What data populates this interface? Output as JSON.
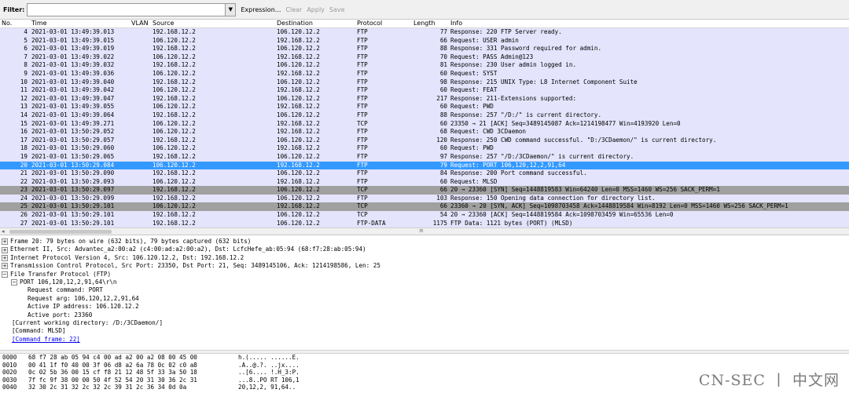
{
  "toolbar": {
    "filter_label": "Filter:",
    "filter_value": "",
    "expression_label": "Expression...",
    "clear_label": "Clear",
    "apply_label": "Apply",
    "save_label": "Save"
  },
  "packet_list": {
    "columns": {
      "no": "No.",
      "time": "Time",
      "vlan": "VLAN",
      "source": "Source",
      "destination": "Destination",
      "protocol": "Protocol",
      "length": "Length",
      "info": "Info"
    },
    "rows": [
      {
        "no": "4",
        "time": "2021-03-01 13:49:39.013",
        "src": "192.168.12.2",
        "dst": "106.120.12.2",
        "proto": "FTP",
        "len": "77",
        "info": "Response: 220 FTP Server ready.",
        "style": "ftp"
      },
      {
        "no": "5",
        "time": "2021-03-01 13:49:39.015",
        "src": "106.120.12.2",
        "dst": "192.168.12.2",
        "proto": "FTP",
        "len": "66",
        "info": "Request: USER admin",
        "style": "ftp"
      },
      {
        "no": "6",
        "time": "2021-03-01 13:49:39.019",
        "src": "192.168.12.2",
        "dst": "106.120.12.2",
        "proto": "FTP",
        "len": "88",
        "info": "Response: 331 Password required for admin.",
        "style": "ftp"
      },
      {
        "no": "7",
        "time": "2021-03-01 13:49:39.022",
        "src": "106.120.12.2",
        "dst": "192.168.12.2",
        "proto": "FTP",
        "len": "70",
        "info": "Request: PASS Admin@123",
        "style": "ftp"
      },
      {
        "no": "8",
        "time": "2021-03-01 13:49:39.032",
        "src": "192.168.12.2",
        "dst": "106.120.12.2",
        "proto": "FTP",
        "len": "81",
        "info": "Response: 230 User admin logged in.",
        "style": "ftp"
      },
      {
        "no": "9",
        "time": "2021-03-01 13:49:39.036",
        "src": "106.120.12.2",
        "dst": "192.168.12.2",
        "proto": "FTP",
        "len": "60",
        "info": "Request: SYST",
        "style": "ftp"
      },
      {
        "no": "10",
        "time": "2021-03-01 13:49:39.040",
        "src": "192.168.12.2",
        "dst": "106.120.12.2",
        "proto": "FTP",
        "len": "98",
        "info": "Response: 215 UNIX Type: L8 Internet Component Suite",
        "style": "ftp"
      },
      {
        "no": "11",
        "time": "2021-03-01 13:49:39.042",
        "src": "106.120.12.2",
        "dst": "192.168.12.2",
        "proto": "FTP",
        "len": "60",
        "info": "Request: FEAT",
        "style": "ftp"
      },
      {
        "no": "12",
        "time": "2021-03-01 13:49:39.047",
        "src": "192.168.12.2",
        "dst": "106.120.12.2",
        "proto": "FTP",
        "len": "217",
        "info": "Response: 211-Extensions supported:",
        "style": "ftp"
      },
      {
        "no": "13",
        "time": "2021-03-01 13:49:39.055",
        "src": "106.120.12.2",
        "dst": "192.168.12.2",
        "proto": "FTP",
        "len": "60",
        "info": "Request: PWD",
        "style": "ftp"
      },
      {
        "no": "14",
        "time": "2021-03-01 13:49:39.064",
        "src": "192.168.12.2",
        "dst": "106.120.12.2",
        "proto": "FTP",
        "len": "88",
        "info": "Response: 257 \"/D:/\" is current directory.",
        "style": "ftp"
      },
      {
        "no": "15",
        "time": "2021-03-01 13:49:39.271",
        "src": "106.120.12.2",
        "dst": "192.168.12.2",
        "proto": "TCP",
        "len": "60",
        "info": "23350 → 21 [ACK] Seq=3489145087 Ack=1214198477 Win=4193920 Len=0",
        "style": "tcp"
      },
      {
        "no": "16",
        "time": "2021-03-01 13:50:29.052",
        "src": "106.120.12.2",
        "dst": "192.168.12.2",
        "proto": "FTP",
        "len": "68",
        "info": "Request: CWD 3CDaemon",
        "style": "ftp"
      },
      {
        "no": "17",
        "time": "2021-03-01 13:50:29.057",
        "src": "192.168.12.2",
        "dst": "106.120.12.2",
        "proto": "FTP",
        "len": "120",
        "info": "Response: 250 CWD command successful. \"D:/3CDaemon/\" is current directory.",
        "style": "ftp"
      },
      {
        "no": "18",
        "time": "2021-03-01 13:50:29.060",
        "src": "106.120.12.2",
        "dst": "192.168.12.2",
        "proto": "FTP",
        "len": "60",
        "info": "Request: PWD",
        "style": "ftp"
      },
      {
        "no": "19",
        "time": "2021-03-01 13:50:29.065",
        "src": "192.168.12.2",
        "dst": "106.120.12.2",
        "proto": "FTP",
        "len": "97",
        "info": "Response: 257 \"/D:/3CDaemon/\" is current directory.",
        "style": "ftp"
      },
      {
        "no": "20",
        "time": "2021-03-01 13:50:29.084",
        "src": "106.120.12.2",
        "dst": "192.168.12.2",
        "proto": "FTP",
        "len": "79",
        "info": "Request: PORT 106,120,12,2,91,64",
        "style": "sel"
      },
      {
        "no": "21",
        "time": "2021-03-01 13:50:29.090",
        "src": "192.168.12.2",
        "dst": "106.120.12.2",
        "proto": "FTP",
        "len": "84",
        "info": "Response: 200 Port command successful.",
        "style": "ftp"
      },
      {
        "no": "22",
        "time": "2021-03-01 13:50:29.093",
        "src": "106.120.12.2",
        "dst": "192.168.12.2",
        "proto": "FTP",
        "len": "60",
        "info": "Request: MLSD",
        "style": "ftp"
      },
      {
        "no": "23",
        "time": "2021-03-01 13:50:29.097",
        "src": "192.168.12.2",
        "dst": "106.120.12.2",
        "proto": "TCP",
        "len": "66",
        "info": "20 → 23360 [SYN] Seq=1448819583 Win=64240 Len=0 MSS=1460 WS=256 SACK_PERM=1",
        "style": "dark"
      },
      {
        "no": "24",
        "time": "2021-03-01 13:50:29.099",
        "src": "192.168.12.2",
        "dst": "106.120.12.2",
        "proto": "FTP",
        "len": "103",
        "info": "Response: 150 Opening data connection for directory list.",
        "style": "ftp"
      },
      {
        "no": "25",
        "time": "2021-03-01 13:50:29.101",
        "src": "106.120.12.2",
        "dst": "192.168.12.2",
        "proto": "TCP",
        "len": "66",
        "info": "23360 → 20 [SYN, ACK] Seq=1098703458 Ack=1448819584 Win=8192 Len=0 MSS=1460 WS=256 SACK_PERM=1",
        "style": "dark"
      },
      {
        "no": "26",
        "time": "2021-03-01 13:50:29.101",
        "src": "192.168.12.2",
        "dst": "106.120.12.2",
        "proto": "TCP",
        "len": "54",
        "info": "20 → 23360 [ACK] Seq=1448819584 Ack=1098703459 Win=65536 Len=0",
        "style": "tcp"
      },
      {
        "no": "27",
        "time": "2021-03-01 13:50:29.101",
        "src": "192.168.12.2",
        "dst": "106.120.12.2",
        "proto": "FTP-DATA",
        "len": "1175",
        "info": "FTP Data: 1121 bytes (PORT) (MLSD)",
        "style": "ftpdata"
      }
    ]
  },
  "details": {
    "frame": "Frame 20: 79 bytes on wire (632 bits), 79 bytes captured (632 bits)",
    "ethernet": "Ethernet II, Src: Advantec_a2:00:a2 (c4:00:ad:a2:00:a2), Dst: LcfcHefe_ab:05:94 (68:f7:28:ab:05:94)",
    "ip": "Internet Protocol Version 4, Src: 106.120.12.2, Dst: 192.168.12.2",
    "tcp": "Transmission Control Protocol, Src Port: 23350, Dst Port: 21, Seq: 3489145106, Ack: 1214198586, Len: 25",
    "ftp": "File Transfer Protocol (FTP)",
    "port_line": "PORT 106,120,12,2,91,64\\r\\n",
    "request_command": "Request command: PORT",
    "request_arg": "Request arg: 106,120,12,2,91,64",
    "active_ip": "Active IP address: 106.120.12.2",
    "active_port": "Active port: 23360",
    "cwd": "[Current working directory: /D:/3CDaemon/]",
    "command": "[Command: MLSD]",
    "command_frame": "[Command frame: 22]"
  },
  "hex": [
    {
      "off": "0000",
      "bytes": "68 f7 28 ab 05 94 c4 00  ad a2 00 a2 08 00 45 00",
      "ascii": "h.(..... ......E."
    },
    {
      "off": "0010",
      "bytes": "00 41 1f f0 40 00 3f 06  d8 a2 6a 78 0c 02 c0 a8",
      "ascii": ".A..@.?. ..jx...."
    },
    {
      "off": "0020",
      "bytes": "0c 02 5b 36 00 15 cf f8  21 12 48 5f 33 3a 50 18",
      "ascii": "..[6.... !.H_3:P."
    },
    {
      "off": "0030",
      "bytes": "7f fc 9f 38 00 00 50 4f  52 54 20 31 30 36 2c 31",
      "ascii": "...8..PO RT 106,1"
    },
    {
      "off": "0040",
      "bytes": "32 30 2c 31 32 2c 32 2c  39 31 2c 36 34 0d 0a",
      "ascii": "20,12,2, 91,64.."
    }
  ],
  "watermark": "CN-SEC 丨 中文网"
}
